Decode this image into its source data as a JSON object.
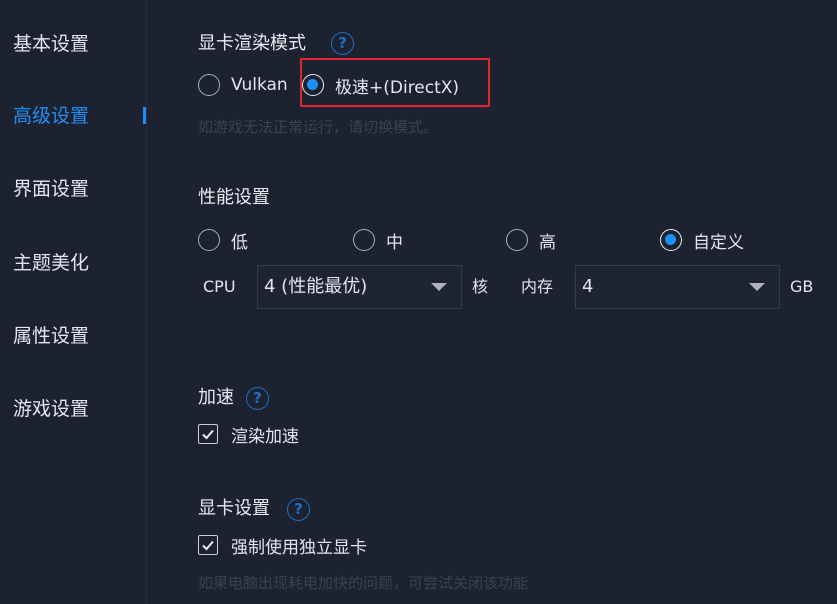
{
  "sidebar": {
    "items": [
      {
        "label": "基本设置"
      },
      {
        "label": "高级设置"
      },
      {
        "label": "界面设置"
      },
      {
        "label": "主题美化"
      },
      {
        "label": "属性设置"
      },
      {
        "label": "游戏设置"
      }
    ],
    "active": "高级设置"
  },
  "render_mode": {
    "title": "显卡渲染模式",
    "help_icon": "question-circle-icon",
    "options": [
      {
        "label": "Vulkan",
        "checked": false
      },
      {
        "label": "极速+(DirectX)",
        "checked": true
      }
    ],
    "hint": "如游戏无法正常运行，请切换模式。"
  },
  "performance": {
    "title": "性能设置",
    "options": [
      {
        "label": "低",
        "checked": false
      },
      {
        "label": "中",
        "checked": false
      },
      {
        "label": "高",
        "checked": false
      },
      {
        "label": "自定义",
        "checked": true
      }
    ],
    "cpu_label": "CPU",
    "cpu_value": "4 (性能最优)",
    "cpu_unit": "核",
    "memory_label": "内存",
    "memory_value": "4",
    "memory_unit": "GB"
  },
  "acceleration": {
    "title": "加速",
    "help_icon": "question-circle-icon",
    "checkbox_label": "渲染加速",
    "checked": true
  },
  "gpu": {
    "title": "显卡设置",
    "help_icon": "question-circle-icon",
    "checkbox_label": "强制使用独立显卡",
    "checked": true,
    "hint": "如果电脑出现耗电加快的问题，可尝试关闭该功能"
  },
  "colors": {
    "accent": "#1e8ff5",
    "background": "#1d2231",
    "highlight_box": "#e0262b"
  }
}
